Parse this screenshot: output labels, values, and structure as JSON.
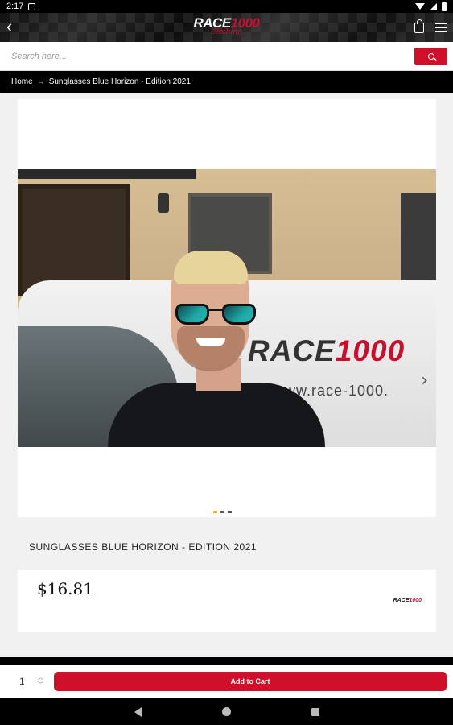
{
  "status_bar": {
    "time": "2:17"
  },
  "header": {
    "logo_text": "RACE",
    "logo_number": "1000",
    "logo_sub": "Clothing",
    "back_icon": "chevron-left-icon",
    "cart_icon": "shopping-bag-icon",
    "menu_icon": "hamburger-menu-icon"
  },
  "search": {
    "placeholder": "Search here...",
    "button_icon": "search-icon"
  },
  "breadcrumb": {
    "home": "Home",
    "separator": "→",
    "current": "Sunglasses Blue Horizon - Edition 2021"
  },
  "gallery": {
    "van_text": "RACE",
    "van_number": "1000",
    "van_url": "www.race-1000.",
    "next_icon": "›",
    "dots": [
      true,
      false,
      false
    ]
  },
  "product": {
    "title": "SUNGLASSES BLUE HORIZON - EDITION 2021",
    "price": "$16.81",
    "brand_text": "RACE",
    "brand_number": "1000"
  },
  "cart": {
    "quantity": "1",
    "add_label": "Add to Cart"
  },
  "colors": {
    "accent": "#d0102a",
    "background": "#f1f1f1",
    "header": "#000000"
  }
}
